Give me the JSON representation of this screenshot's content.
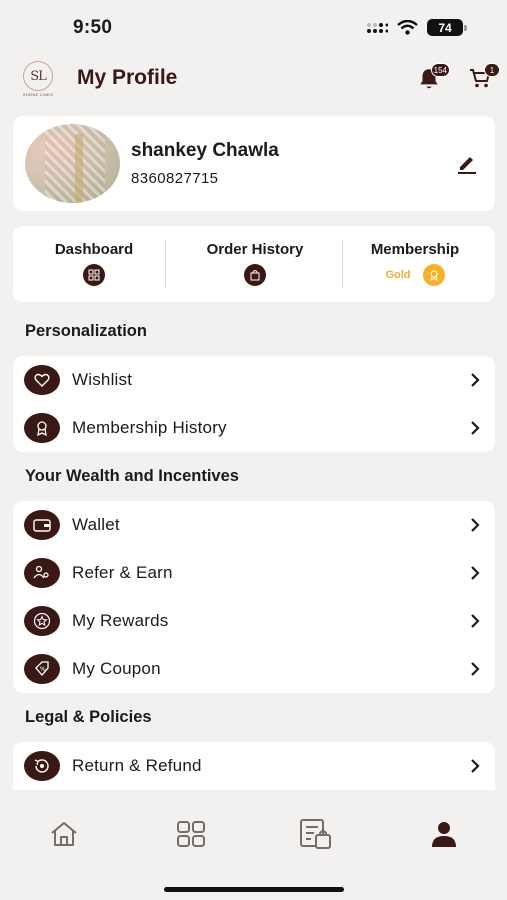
{
  "status_bar": {
    "time": "9:50",
    "battery": "74"
  },
  "header": {
    "logo_text": "SL",
    "logo_subtext": "SHONE LINKS",
    "title": "My Profile",
    "notification_count": "154",
    "cart_count": "1"
  },
  "profile": {
    "name": "shankey Chawla",
    "phone": "8360827715"
  },
  "stats": {
    "dashboard": "Dashboard",
    "order_history": "Order History",
    "membership": "Membership",
    "membership_tier": "Gold"
  },
  "sections": {
    "personalization": "Personalization",
    "wealth": "Your Wealth and Incentives",
    "legal": "Legal & Policies"
  },
  "menu": {
    "wishlist": "Wishlist",
    "membership_history": "Membership History",
    "wallet": "Wallet",
    "refer_earn": "Refer & Earn",
    "my_rewards": "My Rewards",
    "my_coupon": "My Coupon",
    "return_refund": "Return & Refund"
  },
  "icons": {
    "notification": "bell-icon",
    "cart": "cart-icon",
    "edit": "pencil-icon",
    "tabs": [
      "home-icon",
      "grid-icon",
      "orders-icon",
      "profile-icon"
    ]
  },
  "colors": {
    "brand": "#3a1816",
    "background": "#f3f1ef",
    "gold": "#f4b224",
    "card": "#ffffff"
  }
}
